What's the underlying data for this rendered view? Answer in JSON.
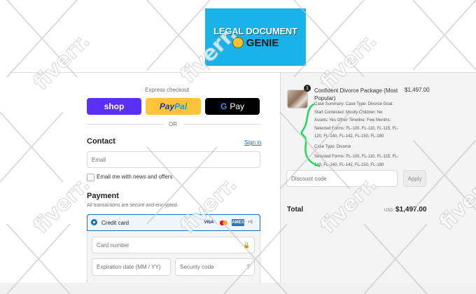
{
  "brand": {
    "line1": "LEGAL DOCUMENT",
    "line2": "GENIE",
    "color": "#19b3ea"
  },
  "express": {
    "label": "Express checkout",
    "shop": "shop",
    "paypal_a": "Pay",
    "paypal_b": "Pal",
    "gpay": "Pay",
    "gpay_g": "G",
    "or": "OR"
  },
  "contact": {
    "heading": "Contact",
    "signin": "Sign in",
    "email_placeholder": "Email",
    "newsletter": "Email me with news and offers"
  },
  "payment": {
    "heading": "Payment",
    "subtitle": "All transactions are secure and encrypted.",
    "method": "Credit card",
    "logos": [
      "VISA",
      "mastercard",
      "AMEX"
    ],
    "more": "+5",
    "card_number": "Card number",
    "expiry": "Expiration date (MM / YY)",
    "security": "Security code"
  },
  "order": {
    "quantity": "1",
    "name": "Confident Divorce Package (Most Popular)",
    "price": "$1,497.00",
    "details": [
      "Case Summary: Case Type: Divorce Goal:",
      "Start Contested: Mostly Children: No",
      "Assets: Yes Other Timeline: Few Months",
      "Selected Forms: FL-100, FL-110, FL-115, FL-120, FL-140, FL-142, FL-150, FL-180",
      "Case Type: Divorce",
      "Selected Forms: FL-100, FL-110, FL-115, FL-120, FL-140, FL-142, FL-150, FL-180"
    ],
    "discount_placeholder": "Discount code",
    "apply": "Apply",
    "total_label": "Total",
    "currency": "USD",
    "total": "$1,497.00"
  },
  "watermark": {
    "text": "fiverr."
  },
  "colors": {
    "shop": "#5a31f4",
    "paypal": "#ffc439",
    "gpay": "#000000",
    "link": "#1773b0"
  }
}
